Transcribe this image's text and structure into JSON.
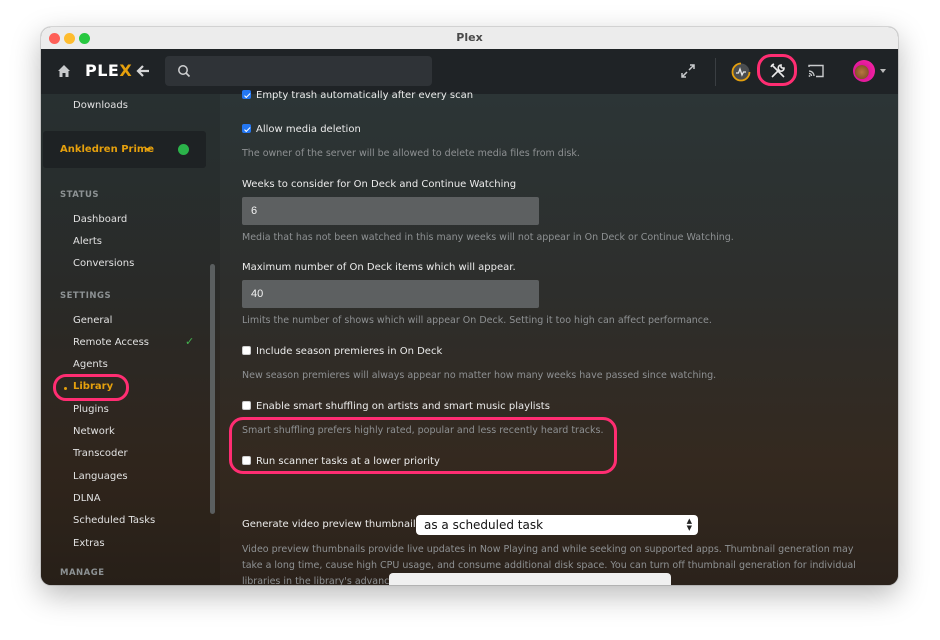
{
  "window": {
    "title": "Plex"
  },
  "topbar": {
    "logo_main": "PLE",
    "logo_accent": "X",
    "search": {
      "value": "",
      "placeholder": ""
    },
    "icons": [
      "home-icon",
      "back-icon",
      "search-icon",
      "expand-icon",
      "activity-icon",
      "tools-icon",
      "cast-icon",
      "avatar"
    ],
    "accent_color": "#e5a00d",
    "highlight_color": "#ff2d72"
  },
  "sidebar": {
    "top_item": "Downloads",
    "server": {
      "name": "Ankledren Prime",
      "status_icon": "lock-icon",
      "status_color": "#2bb34a"
    },
    "sections": [
      {
        "title": "STATUS",
        "items": [
          "Dashboard",
          "Alerts",
          "Conversions"
        ]
      },
      {
        "title": "SETTINGS",
        "items": [
          "General",
          "Remote Access",
          "Agents",
          "Library",
          "Plugins",
          "Network",
          "Transcoder",
          "Languages",
          "DLNA",
          "Scheduled Tasks",
          "Extras"
        ]
      },
      {
        "title": "MANAGE",
        "items": []
      }
    ],
    "active_item": "Library",
    "remote_access_status": "check-icon"
  },
  "settings": {
    "empty_trash": {
      "label": "Empty trash automatically after every scan",
      "checked": true
    },
    "allow_deletion": {
      "label": "Allow media deletion",
      "checked": true,
      "help": "The owner of the server will be allowed to delete media files from disk."
    },
    "weeks_on_deck": {
      "label": "Weeks to consider for On Deck and Continue Watching",
      "value": "6",
      "help": "Media that has not been watched in this many weeks will not appear in On Deck or Continue Watching."
    },
    "max_on_deck": {
      "label": "Maximum number of On Deck items which will appear.",
      "value": "40",
      "help": "Limits the number of shows which will appear On Deck. Setting it too high can affect performance."
    },
    "season_premieres": {
      "label": "Include season premieres in On Deck",
      "checked": false,
      "help": "New season premieres will always appear no matter how many weeks have passed since watching."
    },
    "smart_shuffle": {
      "label": "Enable smart shuffling on artists and smart music playlists",
      "checked": false,
      "help": "Smart shuffling prefers highly rated, popular and less recently heard tracks."
    },
    "low_priority": {
      "label": "Run scanner tasks at a lower priority",
      "checked": false
    },
    "preview_thumbnails": {
      "label": "Generate video preview thumbnails",
      "value": "as a scheduled task",
      "help": "Video preview thumbnails provide live updates in Now Playing and while seeking on supported apps. Thumbnail generation may take a long time, cause high CPU usage, and consume additional disk space. You can turn off thumbnail generation for individual libraries in the library's advanced settings."
    }
  }
}
